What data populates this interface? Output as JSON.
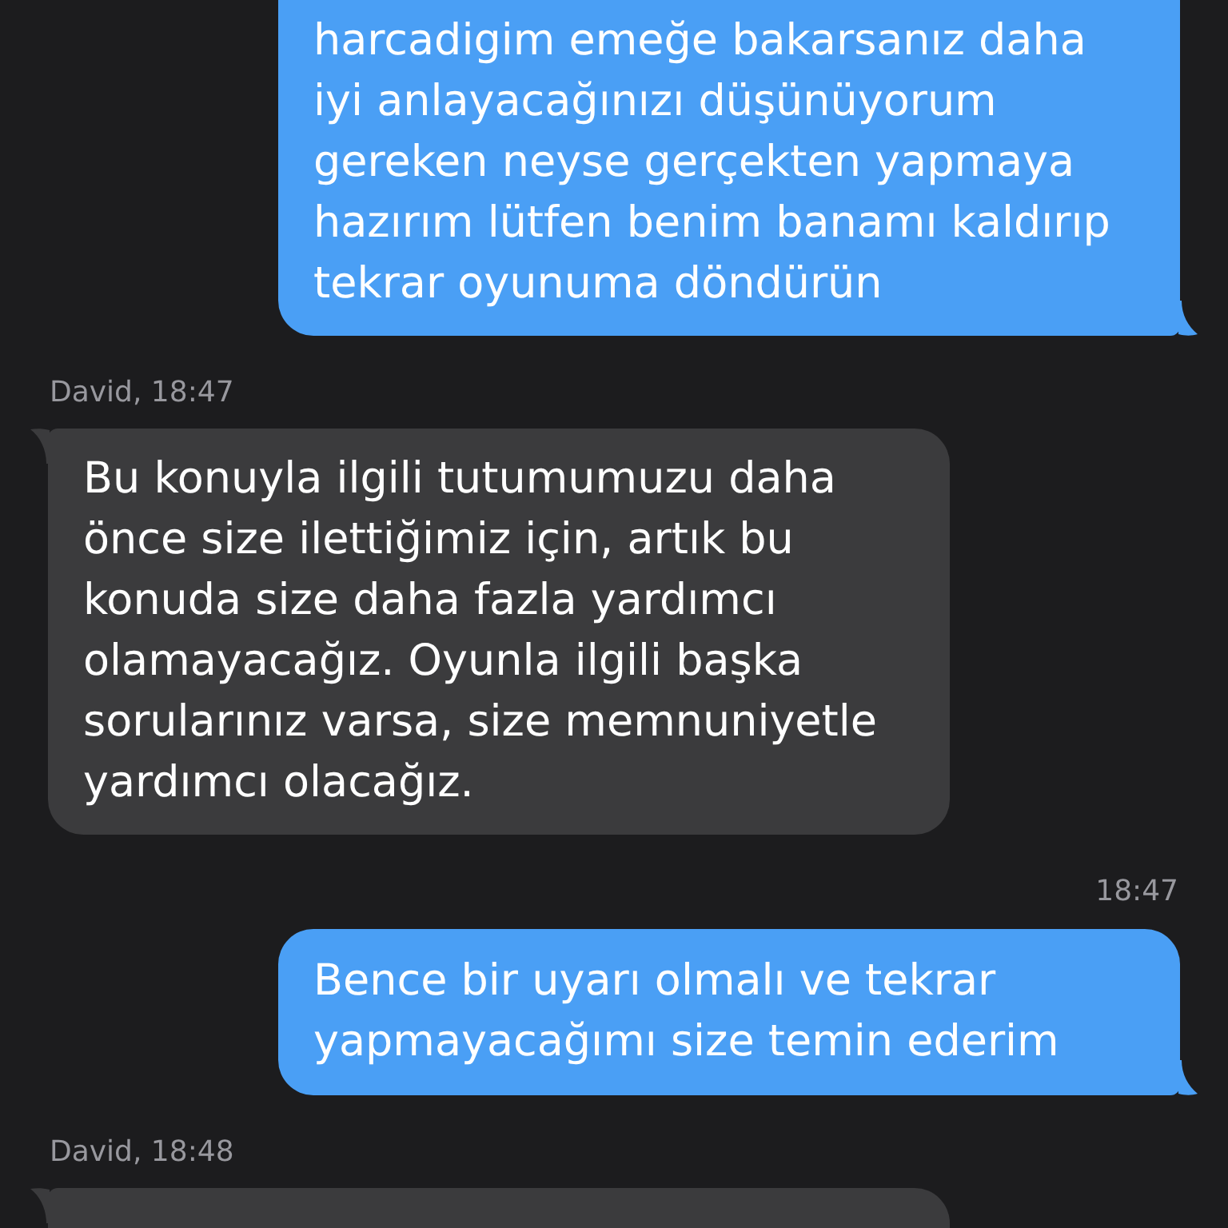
{
  "conversation": {
    "messages": [
      {
        "kind": "outgoing",
        "text": "harcadigim emeğe bakarsanız daha iyi anlayacağınızı düşünüyorum gereken neyse gerçekten yapmaya hazırım lütfen benim banamı kaldırıp tekrar oyunuma döndürün"
      },
      {
        "kind": "incoming",
        "header": "David, 18:47",
        "text": "Bu konuyla ilgili tutumumuzu daha önce size ilettiğimiz için, artık bu konuda size daha fazla yardımcı olamayacağız. Oyunla ilgili başka sorularınız varsa, size memnuniyetle yardımcı olacağız."
      },
      {
        "kind": "outgoing",
        "header": "18:47",
        "text": "Bence bir uyarı olmalı ve tekrar yapmayacağımı size temin ederim"
      },
      {
        "kind": "incoming",
        "header": "David, 18:48"
      }
    ]
  }
}
